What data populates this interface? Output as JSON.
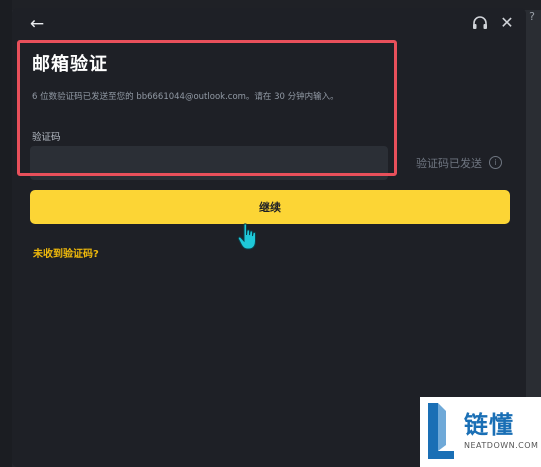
{
  "modal": {
    "title": "邮箱验证",
    "subtitle": "6 位数验证码已发送至您的 bb6661044@outlook.com。请在 30 分钟内输入。",
    "code_label": "验证码",
    "code_value": "",
    "code_status": "验证码已发送",
    "continue_label": "继续",
    "no_code_link": "未收到验证码?"
  },
  "icons": {
    "back": "arrow-left",
    "support": "headset",
    "close": "close-x",
    "info": "info-circle"
  },
  "colors": {
    "accent": "#fcd535",
    "link": "#f0b90b",
    "highlight": "#e8505b",
    "background": "#1e2026"
  },
  "watermark": {
    "text": "链懂",
    "sub": "NEATDOWN.COM"
  }
}
